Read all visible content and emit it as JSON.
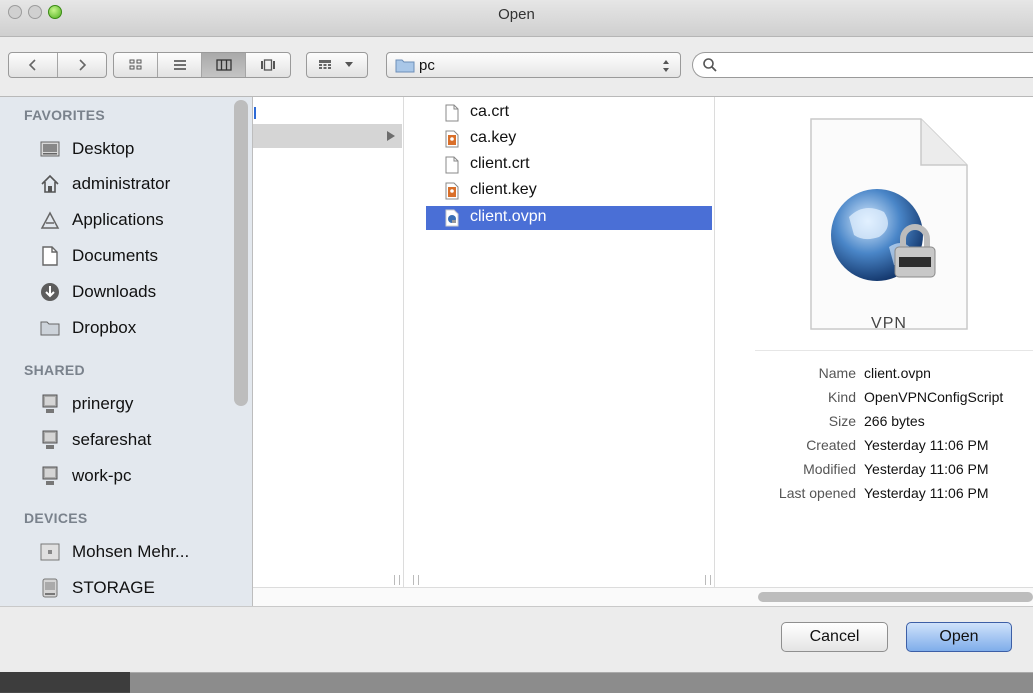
{
  "window": {
    "title": "Open"
  },
  "toolbar": {
    "back_icon": "chevron-left-icon",
    "forward_icon": "chevron-right-icon",
    "views": [
      "icon-view-icon",
      "list-view-icon",
      "column-view-icon",
      "coverflow-view-icon"
    ],
    "active_view": "column-view-icon",
    "arrange_icon": "arrange-grid-icon",
    "path": "pc",
    "search": {
      "value": "",
      "placeholder": ""
    }
  },
  "sidebar": {
    "sections": [
      {
        "heading": "FAVORITES",
        "items": [
          {
            "label": "Desktop",
            "icon": "desktop-icon"
          },
          {
            "label": "administrator",
            "icon": "home-icon"
          },
          {
            "label": "Applications",
            "icon": "applications-icon"
          },
          {
            "label": "Documents",
            "icon": "documents-icon"
          },
          {
            "label": "Downloads",
            "icon": "downloads-icon"
          },
          {
            "label": "Dropbox",
            "icon": "folder-icon"
          }
        ]
      },
      {
        "heading": "SHARED",
        "items": [
          {
            "label": "prinergy",
            "icon": "network-computer-icon"
          },
          {
            "label": "sefareshat",
            "icon": "network-computer-icon"
          },
          {
            "label": "work-pc",
            "icon": "network-computer-icon"
          }
        ]
      },
      {
        "heading": "DEVICES",
        "items": [
          {
            "label": "Mohsen Mehr...",
            "icon": "computer-icon"
          },
          {
            "label": "STORAGE",
            "icon": "drive-icon"
          }
        ]
      }
    ]
  },
  "files": [
    {
      "name": "ca.crt",
      "icon": "document-icon",
      "selected": false
    },
    {
      "name": "ca.key",
      "icon": "key-file-icon",
      "selected": false
    },
    {
      "name": "client.crt",
      "icon": "document-icon",
      "selected": false
    },
    {
      "name": "client.key",
      "icon": "key-file-icon",
      "selected": false
    },
    {
      "name": "client.ovpn",
      "icon": "ovpn-file-icon",
      "selected": true
    }
  ],
  "preview": {
    "badge": "VPN",
    "info": [
      {
        "key": "Name",
        "value": "client.ovpn"
      },
      {
        "key": "Kind",
        "value": "OpenVPNConfigScript"
      },
      {
        "key": "Size",
        "value": "266 bytes"
      },
      {
        "key": "Created",
        "value": "Yesterday 11:06 PM"
      },
      {
        "key": "Modified",
        "value": "Yesterday 11:06 PM"
      },
      {
        "key": "Last opened",
        "value": "Yesterday 11:06 PM"
      }
    ]
  },
  "buttons": {
    "cancel": "Cancel",
    "open": "Open"
  },
  "colors": {
    "selection": "#4a6fd6",
    "sidebar_bg": "#e3e8ee",
    "default_button": "#7fadea"
  }
}
